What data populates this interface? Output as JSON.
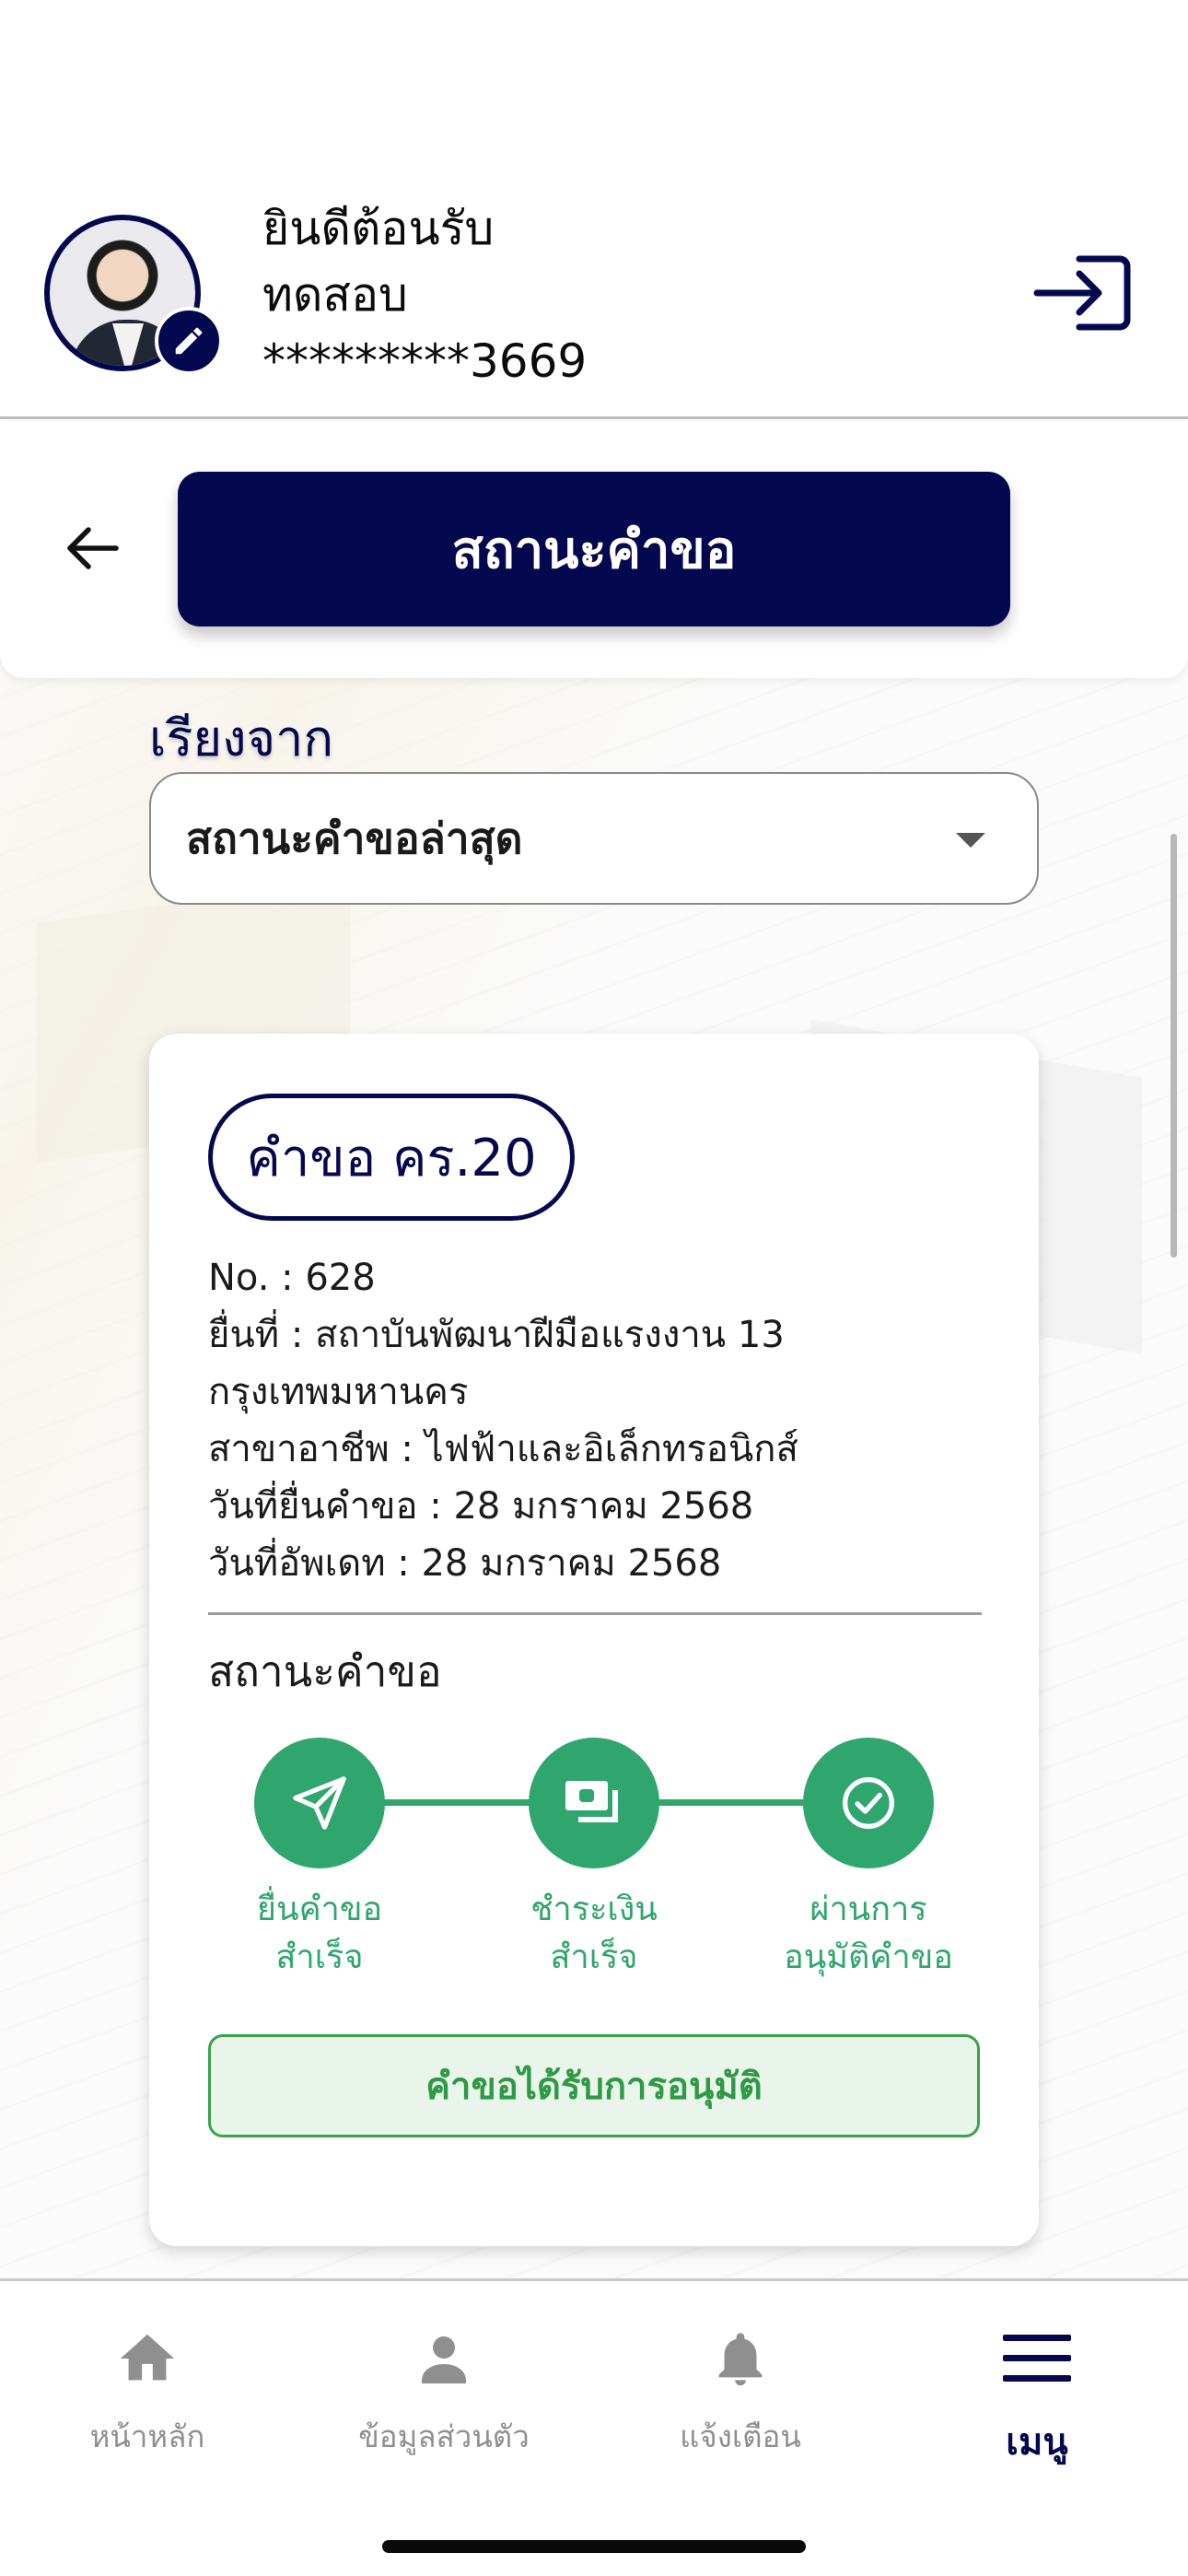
{
  "header": {
    "greeting": "ยินดีต้อนรับ",
    "user_name": "ทดสอบ",
    "masked_id": "*********3669",
    "avatar_icon": "user-photo",
    "edit_icon": "pencil-icon",
    "logout_icon": "logout-icon"
  },
  "page": {
    "title": "สถานะคำขอ",
    "back_icon": "arrow-left-icon"
  },
  "sort": {
    "label": "เรียงจาก",
    "selected": "สถานะคำขอล่าสุด"
  },
  "request": {
    "badge": "คำขอ คร.20",
    "details": [
      "No. : 628",
      "ยื่นที่ : สถาบันพัฒนาฝีมือแรงงาน 13",
      "กรุงเทพมหานคร",
      "สาขาอาชีพ : ไฟฟ้าและอิเล็กทรอนิกส์",
      "วันที่ยื่นคำขอ : 28 มกราคม 2568",
      "วันที่อัพเดท : 28 มกราคม 2568"
    ],
    "status_title": "สถานะคำขอ",
    "steps": [
      {
        "line1": "ยื่นคำขอ",
        "line2": "สำเร็จ",
        "icon": "send-icon"
      },
      {
        "line1": "ชำระเงิน",
        "line2": "สำเร็จ",
        "icon": "payment-icon"
      },
      {
        "line1": "ผ่านการ",
        "line2": "อนุมัติคำขอ",
        "icon": "check-circle-icon"
      }
    ],
    "result": "คำขอได้รับการอนุมัติ"
  },
  "nav": {
    "items": [
      {
        "label": "หน้าหลัก",
        "icon": "home-icon"
      },
      {
        "label": "ข้อมูลส่วนตัว",
        "icon": "person-icon"
      },
      {
        "label": "แจ้งเตือน",
        "icon": "bell-icon"
      },
      {
        "label": "เมนู",
        "icon": "menu-icon"
      }
    ],
    "active_index": 3
  },
  "colors": {
    "navy": "#04094f",
    "green": "#2ea66d",
    "approved_bg": "#e9f5ea",
    "inactive": "#8f8f8f"
  }
}
